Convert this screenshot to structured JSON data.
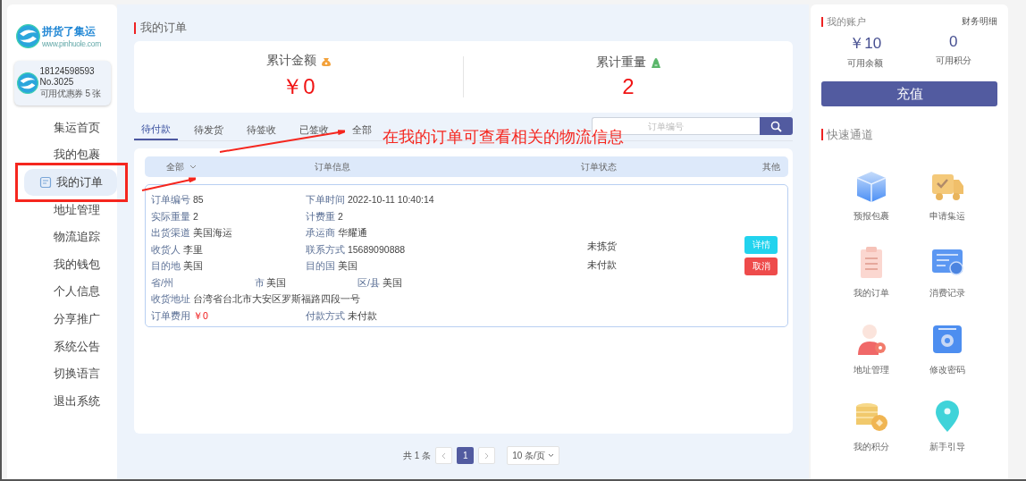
{
  "logo": {
    "name": "拼货了集运",
    "url": "www.pinhuole.com"
  },
  "user": {
    "phone": "18124598593",
    "number": "No.3025",
    "coupon_label": "可用优惠券",
    "coupon_count": "5",
    "coupon_unit": "张"
  },
  "sidebar": {
    "items": [
      {
        "label": "集运首页",
        "selected": false
      },
      {
        "label": "我的包裹",
        "selected": false
      },
      {
        "label": "我的订单",
        "selected": true
      },
      {
        "label": "地址管理",
        "selected": false
      },
      {
        "label": "物流追踪",
        "selected": false
      },
      {
        "label": "我的钱包",
        "selected": false
      },
      {
        "label": "个人信息",
        "selected": false
      },
      {
        "label": "分享推广",
        "selected": false
      },
      {
        "label": "系统公告",
        "selected": false
      },
      {
        "label": "切换语言",
        "selected": false
      },
      {
        "label": "退出系统",
        "selected": false
      }
    ]
  },
  "main": {
    "title": "我的订单",
    "stats": [
      {
        "label": "累计金额",
        "kind": "money",
        "value": "￥0"
      },
      {
        "label": "累计重量",
        "kind": "weight",
        "value": "2"
      }
    ],
    "tabs": [
      {
        "label": "待付款",
        "selected": true
      },
      {
        "label": "待发货",
        "selected": false
      },
      {
        "label": "待签收",
        "selected": false
      },
      {
        "label": "已签收",
        "selected": false
      },
      {
        "label": "全部",
        "selected": false
      }
    ],
    "search": {
      "placeholder": "订单编号"
    },
    "table": {
      "columns": [
        "全部",
        "订单信息",
        "订单状态",
        "其他"
      ]
    },
    "orders": [
      {
        "rows": [
          [
            {
              "label": "订单编号",
              "value": "85"
            },
            {
              "label": "下单时间",
              "value": "2022-10-11 10:40:14"
            }
          ],
          [
            {
              "label": "实际重量",
              "value": "2"
            },
            {
              "label": "计费重",
              "value": "2"
            }
          ],
          [
            {
              "label": "出货渠道",
              "value": "美国海运"
            },
            {
              "label": "承运商",
              "value": "华耀通"
            }
          ],
          [
            {
              "label": "收货人",
              "value": "李里"
            },
            {
              "label": "联系方式",
              "value": "15689090888"
            }
          ],
          [
            {
              "label": "目的地",
              "value": "美国"
            },
            {
              "label": "目的国",
              "value": "美国"
            }
          ],
          [
            {
              "label": "省/州"
            },
            {
              "label": "市",
              "value": "美国"
            },
            {
              "label": "区/县",
              "value": "美国"
            }
          ],
          [
            {
              "label": "收货地址",
              "value": "台湾省台北市大安区罗斯福路四段一号"
            }
          ],
          [
            {
              "label": "订单费用",
              "value": "￥0",
              "kind": "price"
            },
            {
              "label": "付款方式",
              "value": "未付款"
            }
          ]
        ],
        "statuses": [
          "未拣货",
          "未付款"
        ],
        "actions": [
          {
            "label": "详情",
            "kind": "detail"
          },
          {
            "label": "取消",
            "kind": "cancel"
          }
        ]
      }
    ],
    "pagination": {
      "total": "共 1 条",
      "pages": [
        {
          "label": "1",
          "selected": true
        }
      ],
      "page_size": "10 条/页"
    }
  },
  "account": {
    "title": "我的账户",
    "link": "财务明细",
    "balances": [
      {
        "value": "￥10",
        "label": "可用余额"
      },
      {
        "value": "0",
        "label": "可用积分"
      }
    ],
    "recharge": "充值"
  },
  "quick": {
    "title": "快速通道",
    "items": [
      {
        "label": "预报包裹",
        "kind": "box"
      },
      {
        "label": "申请集运",
        "kind": "truck"
      },
      {
        "label": "我的订单",
        "kind": "clipboard"
      },
      {
        "label": "消费记录",
        "kind": "bill"
      },
      {
        "label": "地址管理",
        "kind": "user"
      },
      {
        "label": "修改密码",
        "kind": "gear"
      },
      {
        "label": "我的积分",
        "kind": "coins"
      },
      {
        "label": "新手引导",
        "kind": "pin"
      }
    ]
  },
  "annotation": {
    "text": "在我的订单可查看相关的物流信息"
  }
}
